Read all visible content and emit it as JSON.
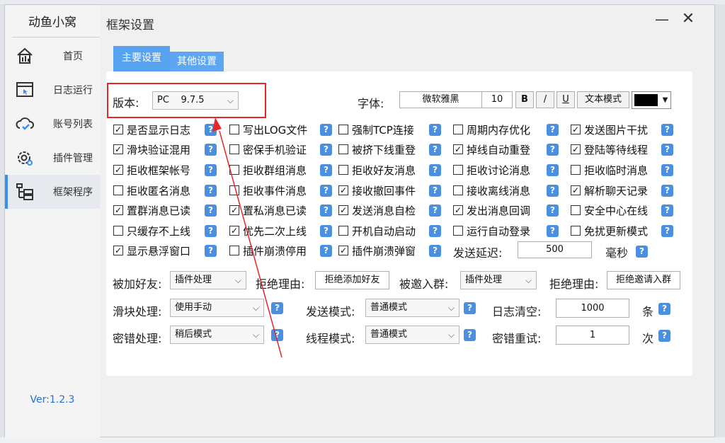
{
  "app": {
    "title": "动鱼小窝",
    "version": "Ver:1.2.3"
  },
  "window": {
    "page_title": "框架设置",
    "minimize": "—",
    "close": "✕"
  },
  "sidebar": {
    "items": [
      {
        "label": "首页",
        "icon": "home-icon"
      },
      {
        "label": "日志运行",
        "icon": "log-window-icon"
      },
      {
        "label": "账号列表",
        "icon": "cloud-check-icon"
      },
      {
        "label": "插件管理",
        "icon": "gear-icon"
      },
      {
        "label": "框架程序",
        "icon": "tree-icon",
        "active": true
      }
    ]
  },
  "tabs": {
    "main": "主要设置",
    "other": "其他设置"
  },
  "version_row": {
    "label": "版本:",
    "version_value": "PC    9.7.5",
    "font_label": "字体:",
    "font_name": "微软雅黑",
    "font_size": "10",
    "bold": "B",
    "italic": "/",
    "underline": "U",
    "text_mode": "文本模式",
    "color": "#000000"
  },
  "checkboxes": [
    {
      "label": "是否显示日志",
      "checked": true
    },
    {
      "label": "写出LOG文件",
      "checked": false
    },
    {
      "label": "强制TCP连接",
      "checked": false
    },
    {
      "label": "周期内存优化",
      "checked": false
    },
    {
      "label": "发送图片干扰",
      "checked": true
    },
    {
      "label": "滑块验证混用",
      "checked": true
    },
    {
      "label": "密保手机验证",
      "checked": false
    },
    {
      "label": "被挤下线重登",
      "checked": false
    },
    {
      "label": "掉线自动重登",
      "checked": true
    },
    {
      "label": "登陆等待线程",
      "checked": true
    },
    {
      "label": "拒收框架帐号",
      "checked": true
    },
    {
      "label": "拒收群组消息",
      "checked": false
    },
    {
      "label": "拒收好友消息",
      "checked": false
    },
    {
      "label": "拒收讨论消息",
      "checked": false
    },
    {
      "label": "拒收临时消息",
      "checked": false
    },
    {
      "label": "拒收匿名消息",
      "checked": false
    },
    {
      "label": "拒收事件消息",
      "checked": false
    },
    {
      "label": "接收撤回事件",
      "checked": true
    },
    {
      "label": "接收离线消息",
      "checked": false
    },
    {
      "label": "解析聊天记录",
      "checked": true
    },
    {
      "label": "置群消息已读",
      "checked": true
    },
    {
      "label": "置私消息已读",
      "checked": true
    },
    {
      "label": "发送消息自检",
      "checked": true
    },
    {
      "label": "发出消息回调",
      "checked": true
    },
    {
      "label": "安全中心在线",
      "checked": false
    },
    {
      "label": "只缓存不上线",
      "checked": false
    },
    {
      "label": "优先二次上线",
      "checked": true
    },
    {
      "label": "开机自动启动",
      "checked": false
    },
    {
      "label": "运行自动登录",
      "checked": false
    },
    {
      "label": "免扰更新模式",
      "checked": false
    },
    {
      "label": "显示悬浮窗口",
      "checked": true
    },
    {
      "label": "插件崩溃停用",
      "checked": false
    },
    {
      "label": "插件崩溃弹窗",
      "checked": true
    }
  ],
  "send_delay": {
    "label": "发送延迟:",
    "value": "500",
    "unit": "毫秒"
  },
  "friend_row": {
    "label": "被加好友:",
    "select": "插件处理",
    "reason_label": "拒绝理由:",
    "reason": "拒绝添加好友",
    "group_label": "被邀入群:",
    "group_select": "插件处理",
    "group_reason_label": "拒绝理由:",
    "group_reason": "拒绝邀请入群"
  },
  "slider_row": {
    "label": "滑块处理:",
    "select": "使用手动",
    "send_mode_label": "发送模式:",
    "send_mode": "普通模式",
    "log_clear_label": "日志清空:",
    "log_clear": "1000",
    "log_clear_unit": "条"
  },
  "pwd_row": {
    "label": "密错处理:",
    "select": "稍后模式",
    "thread_label": "线程模式:",
    "thread_mode": "普通模式",
    "retry_label": "密错重试:",
    "retry": "1",
    "retry_unit": "次"
  },
  "help_glyph": "?",
  "check_glyph": "✓",
  "chevron": "⌵",
  "colors": {
    "accent": "#57a3f2",
    "highlight": "#e8262a",
    "help": "#4b8fe0",
    "version": "#2b6fd6"
  }
}
